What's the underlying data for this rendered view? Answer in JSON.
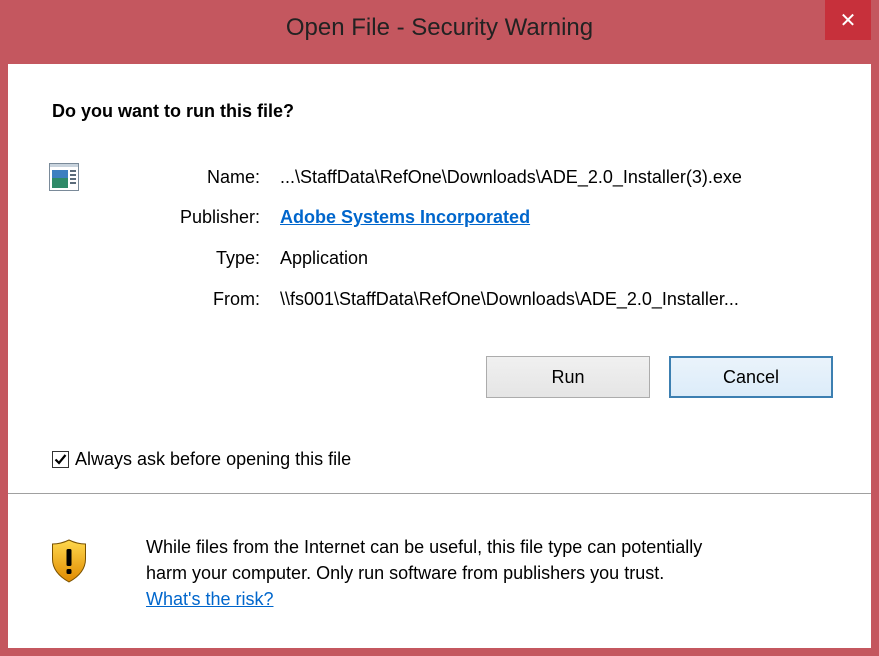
{
  "window": {
    "title": "Open File - Security Warning",
    "close_symbol": "✕",
    "titlebar_color": "#c4575f",
    "close_button_color": "#c7303b"
  },
  "dialog": {
    "question": "Do you want to run this file?",
    "file_icon": "application-window-icon",
    "fields": {
      "name_label": "Name:",
      "name_value": "...\\StaffData\\RefOne\\Downloads\\ADE_2.0_Installer(3).exe",
      "publisher_label": "Publisher:",
      "publisher_value": "Adobe Systems Incorporated",
      "type_label": "Type:",
      "type_value": "Application",
      "from_label": "From:",
      "from_value": "\\\\fs001\\StaffData\\RefOne\\Downloads\\ADE_2.0_Installer..."
    },
    "buttons": {
      "run_label": "Run",
      "cancel_label": "Cancel"
    },
    "checkbox": {
      "label": "Always ask before opening this file",
      "checked": true
    },
    "warning": {
      "icon": "shield-warning-icon",
      "text_line1": "While files from the Internet can be useful, this file type can potentially",
      "text_line2": "harm your computer. Only run software from publishers you trust.",
      "risk_link": "What's the risk?"
    },
    "link_color": "#0066cc"
  }
}
